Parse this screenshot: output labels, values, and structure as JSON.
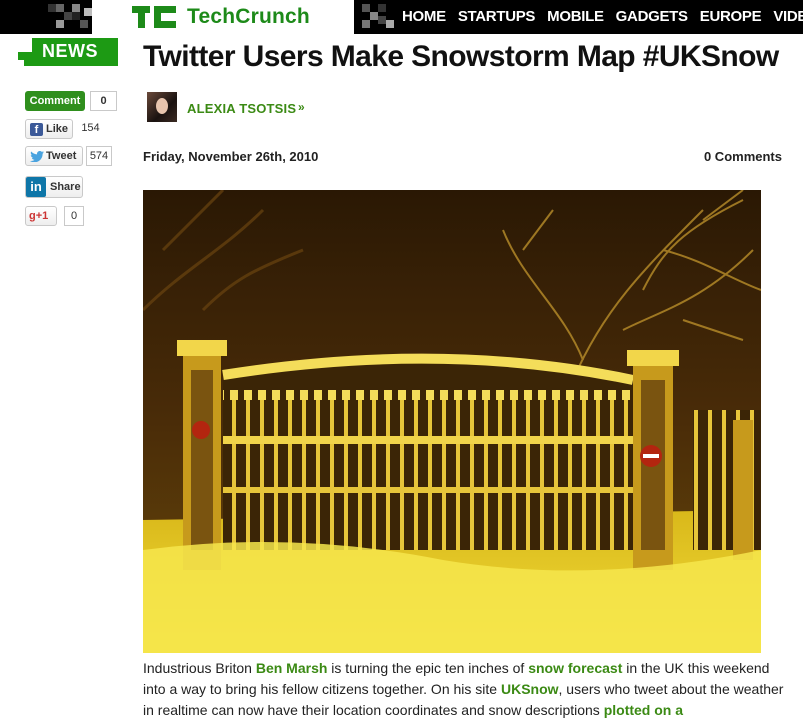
{
  "brand": {
    "name": "TechCrunch",
    "color": "#1d8a19"
  },
  "nav": [
    "HOME",
    "STARTUPS",
    "MOBILE",
    "GADGETS",
    "EUROPE",
    "VIDE"
  ],
  "section_tag": "NEWS",
  "article": {
    "title": "Twitter Users Make Snowstorm Map #UKSnow",
    "author": "ALEXIA TSOTSIS",
    "date": "Friday, November 26th, 2010",
    "comments": "0 Comments",
    "body": [
      {
        "t": "Industrious Briton "
      },
      {
        "t": "Ben Marsh",
        "link": true
      },
      {
        "t": " is turning the epic ten inches of "
      },
      {
        "t": "snow forecast",
        "link": true
      },
      {
        "t": " in the UK this weekend into a way to bring his fellow citizens together. On his site "
      },
      {
        "t": "UKSnow",
        "link": true
      },
      {
        "t": ", users who tweet about the weather in realtime can now have their location coordinates and snow descriptions "
      },
      {
        "t": "plotted on a",
        "link": true
      }
    ]
  },
  "share": {
    "comment": {
      "label": "Comment",
      "count": "0"
    },
    "facebook": {
      "label": "Like",
      "count": "154",
      "icon": "facebook-icon"
    },
    "twitter": {
      "label": "Tweet",
      "count": "574",
      "icon": "twitter-bird-icon"
    },
    "linkedin": {
      "label": "Share",
      "icon": "linkedin-icon"
    },
    "google": {
      "label": "+1",
      "count": "0",
      "icon": "google-plus-icon"
    }
  },
  "colors": {
    "accent": "#1d9a14",
    "link": "#3b8a14",
    "topbar": "#000000"
  }
}
